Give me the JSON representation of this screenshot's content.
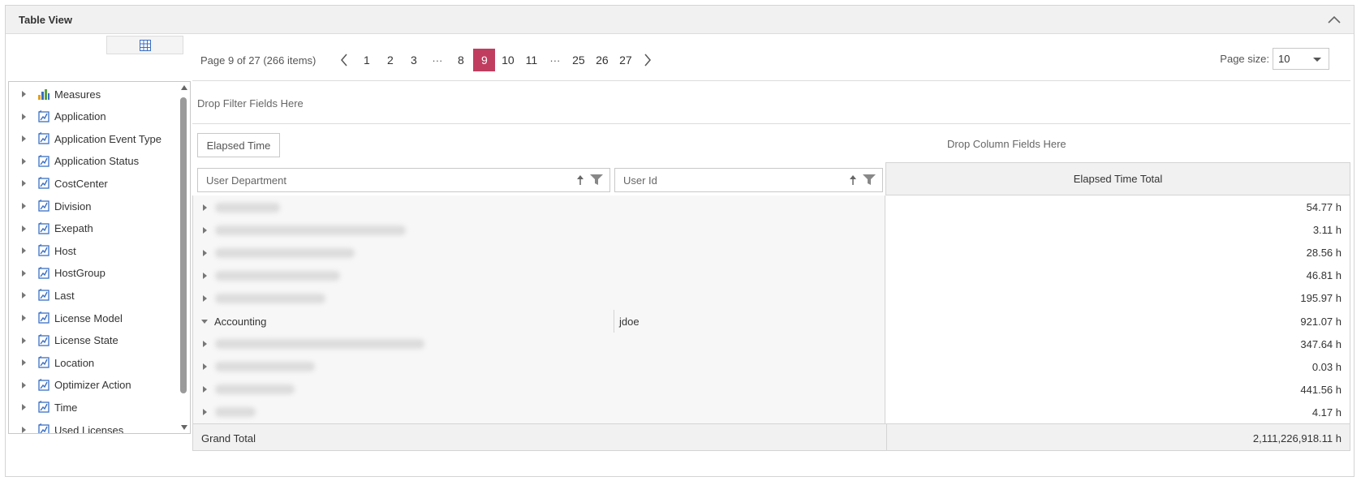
{
  "panel": {
    "title": "Table View"
  },
  "pager": {
    "info": "Page 9 of 27 (266 items)",
    "pages": [
      "1",
      "2",
      "3",
      "...",
      "8",
      "9",
      "10",
      "11",
      "...",
      "25",
      "26",
      "27"
    ],
    "current": "9",
    "page_size_label": "Page size:",
    "page_size_value": "10"
  },
  "fields": [
    {
      "label": "Measures",
      "icon": "measures-icon"
    },
    {
      "label": "Application",
      "icon": "dimension-icon"
    },
    {
      "label": "Application Event Type",
      "icon": "dimension-icon"
    },
    {
      "label": "Application Status",
      "icon": "dimension-icon"
    },
    {
      "label": "CostCenter",
      "icon": "dimension-icon"
    },
    {
      "label": "Division",
      "icon": "dimension-icon"
    },
    {
      "label": "Exepath",
      "icon": "dimension-icon"
    },
    {
      "label": "Host",
      "icon": "dimension-icon"
    },
    {
      "label": "HostGroup",
      "icon": "dimension-icon"
    },
    {
      "label": "Last",
      "icon": "dimension-icon"
    },
    {
      "label": "License Model",
      "icon": "dimension-icon"
    },
    {
      "label": "License State",
      "icon": "dimension-icon"
    },
    {
      "label": "Location",
      "icon": "dimension-icon"
    },
    {
      "label": "Optimizer Action",
      "icon": "dimension-icon"
    },
    {
      "label": "Time",
      "icon": "dimension-icon"
    },
    {
      "label": "Used Licenses",
      "icon": "dimension-icon"
    }
  ],
  "pivot": {
    "filter_drop_label": "Drop Filter Fields Here",
    "data_field": "Elapsed Time",
    "column_drop_label": "Drop Column Fields Here",
    "row_fields": [
      "User Department",
      "User Id"
    ],
    "column_header": "Elapsed Time Total",
    "rows": [
      {
        "department": "",
        "user_id": "",
        "value": "54.77 h",
        "expanded": false
      },
      {
        "department": "",
        "user_id": "",
        "value": "3.11 h",
        "expanded": false
      },
      {
        "department": "",
        "user_id": "",
        "value": "28.56 h",
        "expanded": false
      },
      {
        "department": "",
        "user_id": "",
        "value": "46.81 h",
        "expanded": false
      },
      {
        "department": "",
        "user_id": "",
        "value": "195.97 h",
        "expanded": false
      },
      {
        "department": "Accounting",
        "user_id": "jdoe",
        "value": "921.07 h",
        "expanded": true
      },
      {
        "department": "",
        "user_id": "",
        "value": "347.64 h",
        "expanded": false
      },
      {
        "department": "",
        "user_id": "",
        "value": "0.03 h",
        "expanded": false
      },
      {
        "department": "",
        "user_id": "",
        "value": "441.56 h",
        "expanded": false
      },
      {
        "department": "",
        "user_id": "",
        "value": "4.17 h",
        "expanded": false
      }
    ],
    "grand_total_label": "Grand Total",
    "grand_total_value": "2,111,226,918.11 h"
  },
  "colors": {
    "accent": "#c03d60",
    "icon_blue": "#3a6fc4"
  }
}
